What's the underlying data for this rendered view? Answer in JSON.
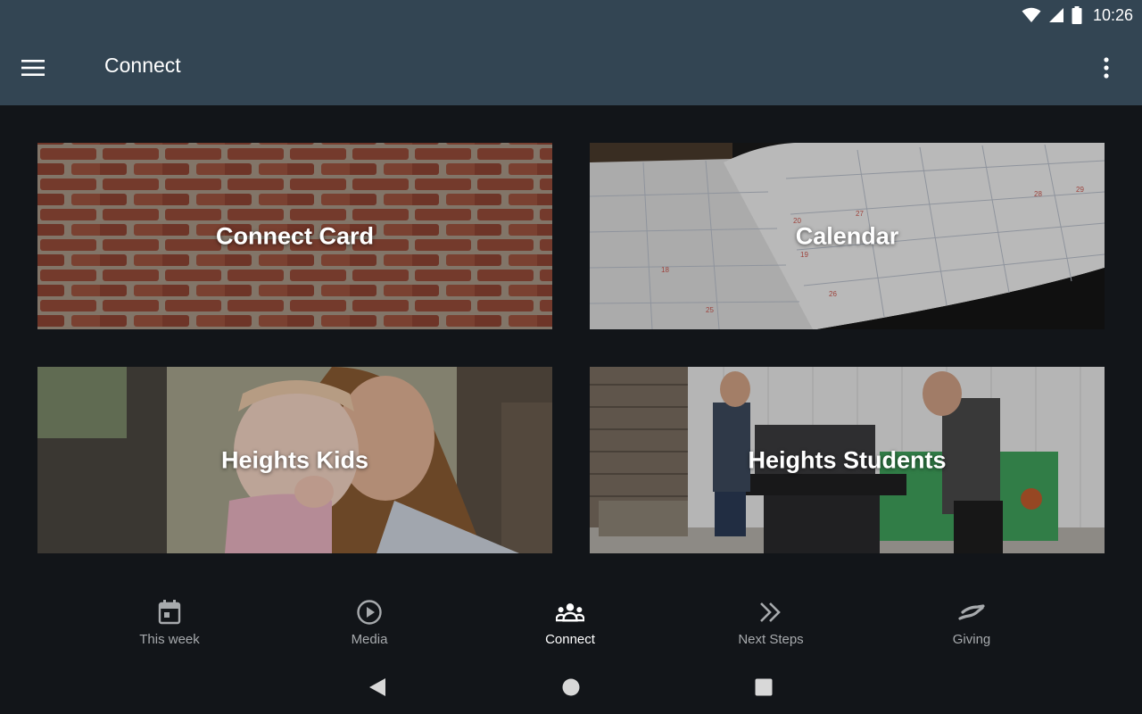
{
  "status_bar": {
    "time": "10:26",
    "icons": [
      "wifi-icon",
      "signal-icon",
      "battery-icon"
    ]
  },
  "app_bar": {
    "title": "Connect",
    "menu_icon": "hamburger-menu-icon",
    "overflow_icon": "more-vert-icon"
  },
  "cards": [
    {
      "label": "Connect Card",
      "image": "brick-wall"
    },
    {
      "label": "Calendar",
      "image": "open-planner"
    },
    {
      "label": "Heights Kids",
      "image": "mother-and-baby"
    },
    {
      "label": "Heights Students",
      "image": "foosball-players"
    }
  ],
  "bottom_nav": {
    "items": [
      {
        "label": "This week",
        "icon": "calendar-icon",
        "active": false
      },
      {
        "label": "Media",
        "icon": "play-circle-icon",
        "active": false
      },
      {
        "label": "Connect",
        "icon": "people-group-icon",
        "active": true
      },
      {
        "label": "Next Steps",
        "icon": "double-chevron-right-icon",
        "active": false
      },
      {
        "label": "Giving",
        "icon": "hand-give-icon",
        "active": false
      }
    ]
  },
  "system_nav": {
    "icons": [
      "back-icon",
      "home-icon",
      "recents-icon"
    ]
  },
  "colors": {
    "app_bar": "#334553",
    "background": "#121519",
    "inactive_label": "#a7aaad",
    "active_label": "#ffffff"
  }
}
